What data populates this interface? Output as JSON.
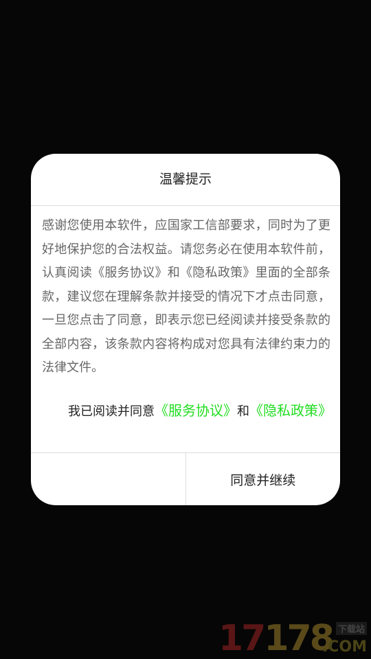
{
  "dialog": {
    "title": "温馨提示",
    "body": "感谢您使用本软件，应国家工信部要求，同时为了更好地保护您的合法权益。请您务必在使用本软件前，认真阅读《服务协议》和《隐私政策》里面的全部条款，建议您在理解条款并接受的情况下才点击同意，一旦您点击了同意，即表示您已经阅读并接受条款的全部内容，该条款内容将构成对您具有法律约束力的法律文件。",
    "agree_prefix": "我已阅读并同意",
    "service_link": "《服务协议》",
    "conjunction": "和",
    "privacy_link": "《隐私政策》",
    "left_button": "",
    "right_button": "同意并继续"
  },
  "watermark": {
    "num_a": "17",
    "num_b": "178",
    "tag": "下载站",
    "domain": ".COM"
  },
  "colors": {
    "background": "#060606",
    "dialog": "#ffffff",
    "link": "#22dd22",
    "body_text": "#666666"
  }
}
